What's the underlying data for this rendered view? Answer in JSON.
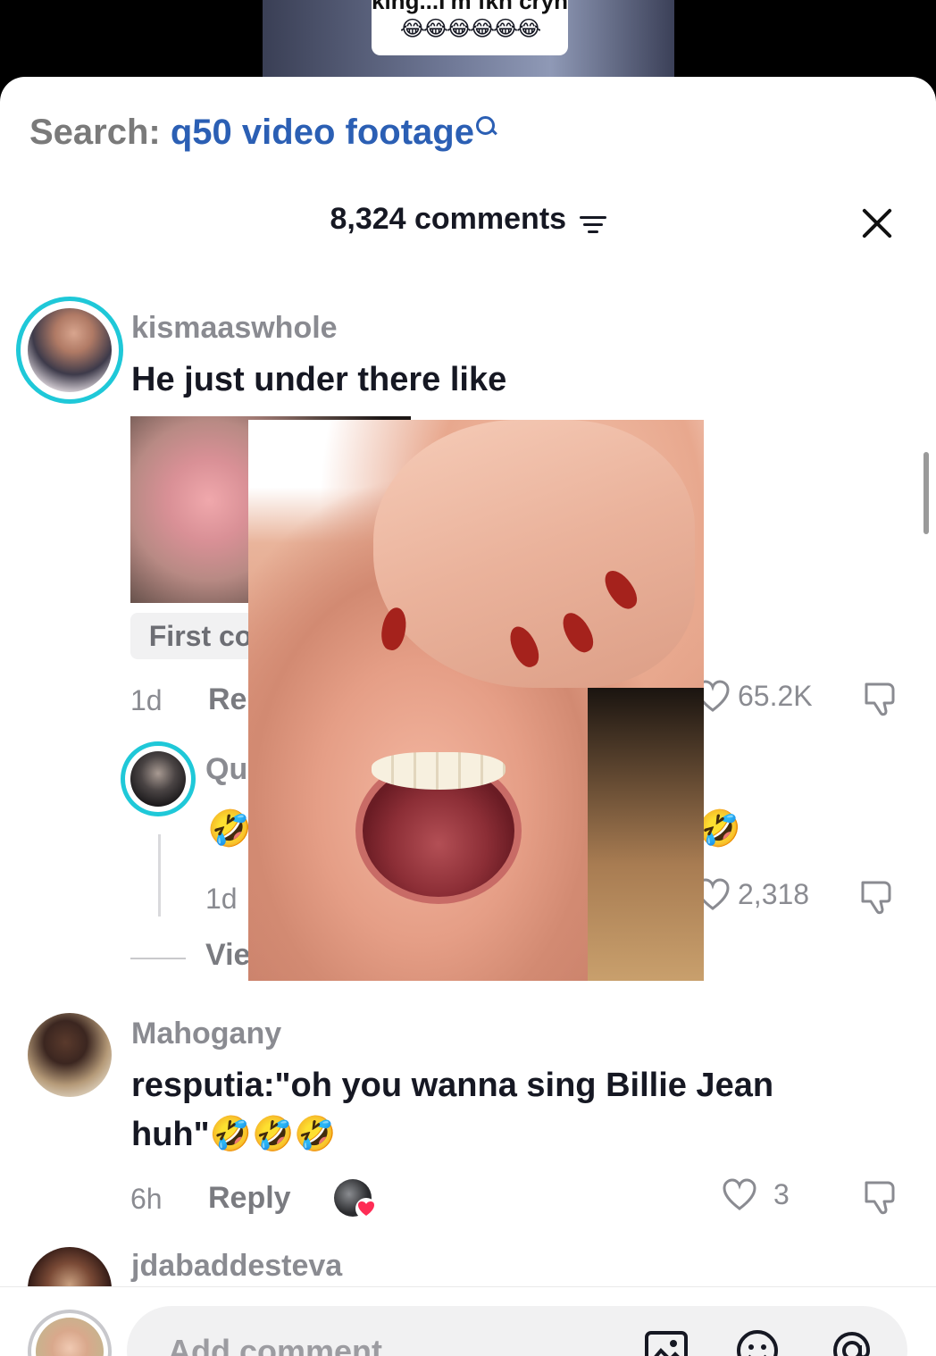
{
  "video": {
    "caption_text": "king...I'm fkn cryn",
    "caption_emojis": "😂😂😂😂😂😂"
  },
  "search": {
    "label": "Search:",
    "query": "q50 video footage"
  },
  "comments_header": {
    "count_label": "8,324 comments"
  },
  "comments": [
    {
      "username": "kismaaswhole",
      "text": "He just under there like",
      "badge": "First comment",
      "age": "1d",
      "reply_label": "Reply",
      "likes": "65.2K"
    },
    {
      "username": "Mahogany",
      "text": "resputia:\"oh you wanna sing Billie Jean huh\"🤣🤣🤣",
      "age": "6h",
      "reply_label": "Reply",
      "likes": "3"
    },
    {
      "username": "jdabaddesteva"
    }
  ],
  "reply": {
    "username_partial": "Quee",
    "emoji_left": "🤣",
    "emoji_right": "🤣",
    "age": "1d",
    "likes": "2,318",
    "view_replies_partial": "Vie"
  },
  "composer": {
    "placeholder": "Add comment"
  },
  "colors": {
    "accent_blue": "#2b5fb4",
    "ring_teal": "#1fc8d8",
    "liked_red": "#fe2c55"
  }
}
